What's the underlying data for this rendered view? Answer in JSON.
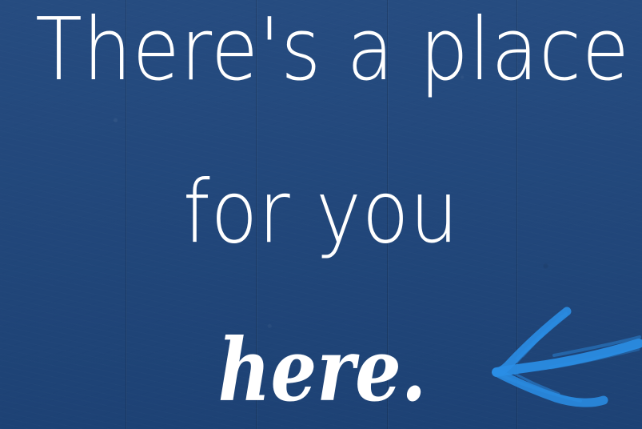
{
  "headline": {
    "line_1": "There's a place",
    "line_2": "for you",
    "line_3": "here."
  },
  "colors": {
    "background": "#1f467c",
    "text": "#ffffff",
    "accent": "#2a8ee5"
  },
  "icons": {
    "arrow": "hand-drawn-arrow-icon"
  }
}
